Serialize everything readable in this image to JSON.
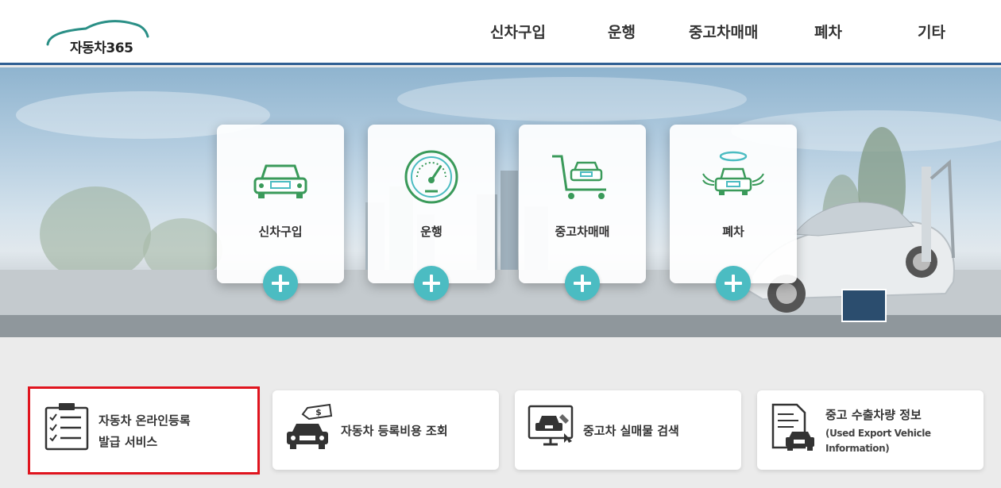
{
  "logo": {
    "text": "자동차365"
  },
  "nav": {
    "items": [
      "신차구입",
      "운행",
      "중고차매매",
      "폐차",
      "기타"
    ]
  },
  "cards": [
    {
      "label": "신차구입",
      "icon": "car-icon"
    },
    {
      "label": "운행",
      "icon": "speedometer-icon"
    },
    {
      "label": "중고차매매",
      "icon": "shopping-cart-car-icon"
    },
    {
      "label": "폐차",
      "icon": "angel-car-icon"
    }
  ],
  "services": [
    {
      "line1": "자동차 온라인등록",
      "line2": "발급 서비스",
      "icon": "checklist-clipboard-icon",
      "selected": true
    },
    {
      "line1": "자동차 등록비용 조회",
      "icon": "car-price-tag-icon"
    },
    {
      "line1": "중고차 실매물 검색",
      "icon": "monitor-car-search-icon"
    },
    {
      "line1": "중고 수출차량 정보",
      "sub1": "(Used Export Vehicle",
      "sub2": "Information)",
      "icon": "document-car-icon"
    }
  ],
  "colors": {
    "accent": "#4bbcc2",
    "header_line": "#2f5f93",
    "selection": "#e0141e",
    "icon_green": "#3a9a5a"
  }
}
